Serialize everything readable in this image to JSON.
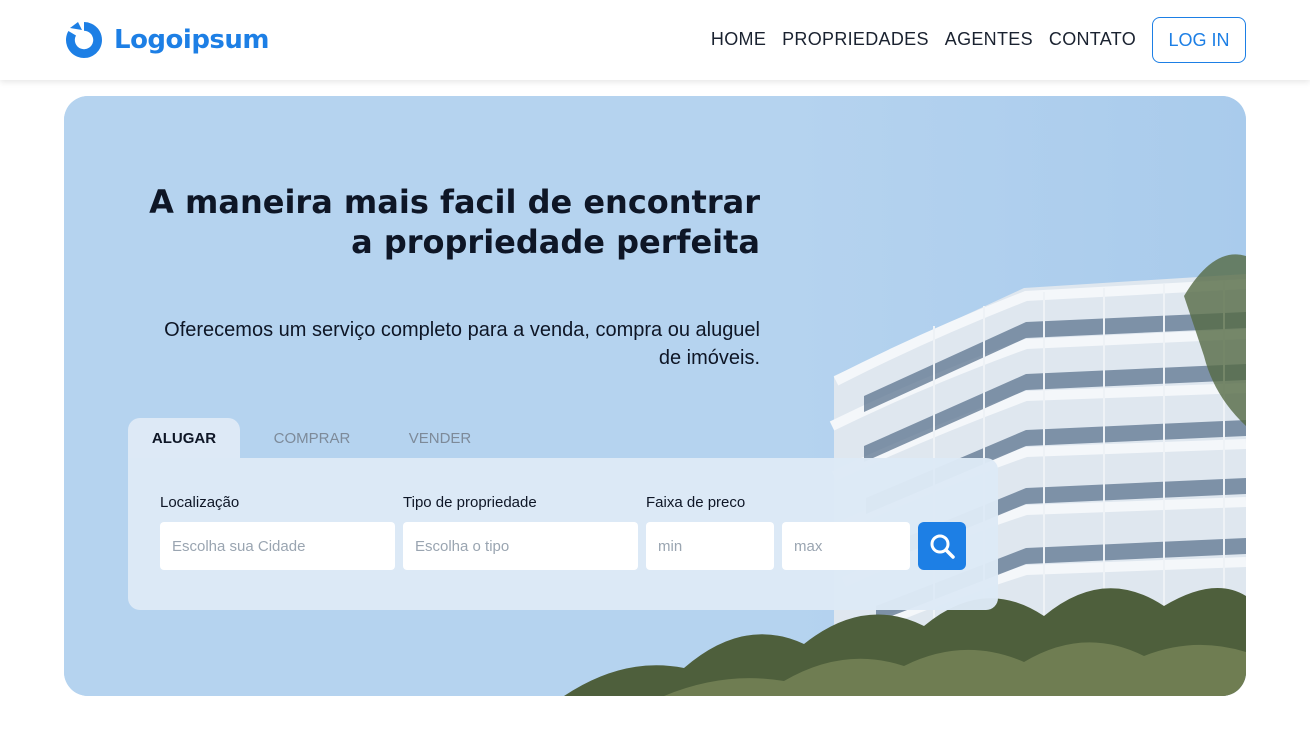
{
  "header": {
    "logo_text": "Logoipsum",
    "nav": [
      "HOME",
      "PROPRIEDADES",
      "AGENTES",
      "CONTATO"
    ],
    "login_label": "LOG IN"
  },
  "hero": {
    "title": "A maneira mais facil de encontrar a propriedade perfeita",
    "subtitle": "Oferecemos um serviço completo para a venda, compra ou aluguel de imóveis."
  },
  "search": {
    "tabs": [
      "ALUGAR",
      "COMPRAR",
      "VENDER"
    ],
    "active_tab": "ALUGAR",
    "location_label": "Localização",
    "location_placeholder": "Escolha sua Cidade",
    "type_label": "Tipo de propriedade",
    "type_placeholder": "Escolha o tipo",
    "price_label": "Faixa de preco",
    "min_placeholder": "min",
    "max_placeholder": "max"
  },
  "icons": {
    "logo": "logo-mark-icon",
    "search": "search-icon"
  },
  "colors": {
    "brand": "#1d7fe5",
    "hero_bg": "#b5d3ef",
    "panel_bg": "#dde9f6",
    "text_dark": "#0e1626"
  }
}
